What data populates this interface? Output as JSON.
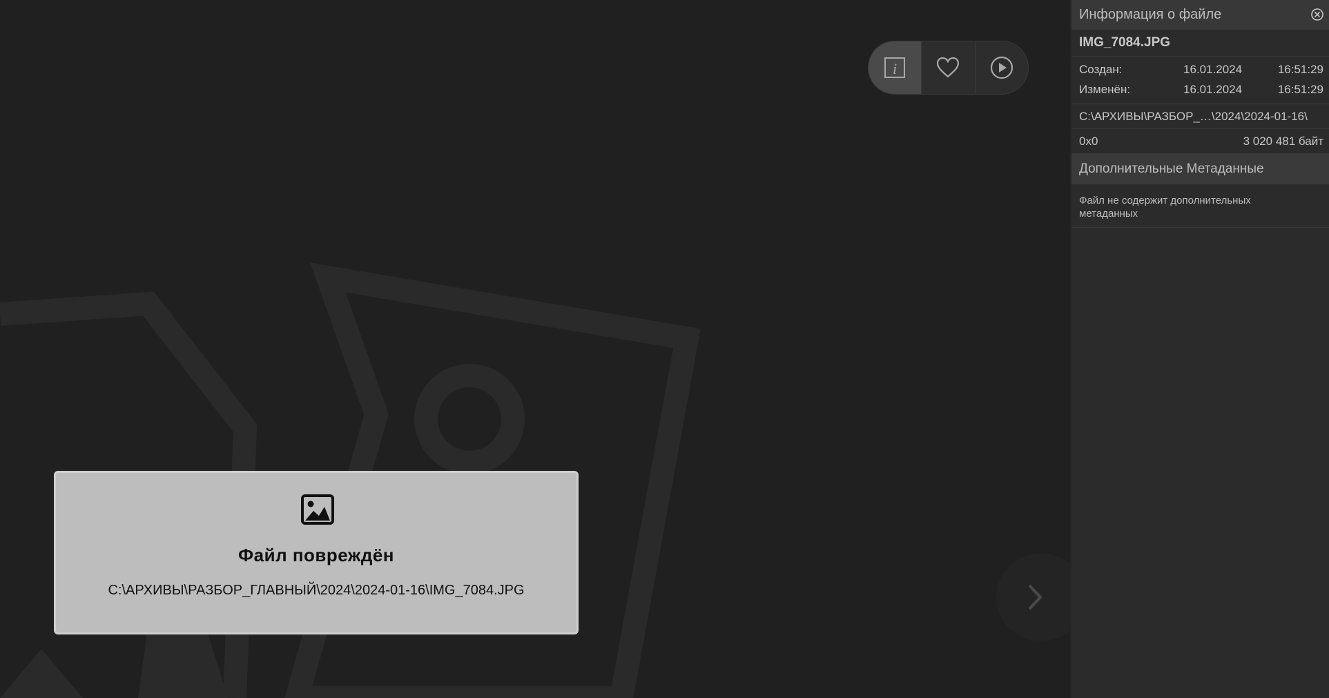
{
  "toolbar": {
    "buttons": [
      {
        "icon": "info-icon",
        "active": true
      },
      {
        "icon": "heart-icon",
        "active": false
      },
      {
        "icon": "play-icon",
        "active": false
      }
    ]
  },
  "error": {
    "icon": "image-icon",
    "title": "Файл повреждён",
    "path": "C:\\АРХИВЫ\\РАЗБОР_ГЛАВНЫЙ\\2024\\2024-01-16\\IMG_7084.JPG"
  },
  "navigation": {
    "next_icon": "chevron-right-icon"
  },
  "panel": {
    "title": "Информация о файле",
    "close_icon": "close-circle-icon",
    "file_name": "IMG_7084.JPG",
    "created": {
      "label": "Создан:",
      "date": "16.01.2024",
      "time": "16:51:29"
    },
    "modified": {
      "label": "Изменён:",
      "date": "16.01.2024",
      "time": "16:51:29"
    },
    "path": "C:\\АРХИВЫ\\РАЗБОР_…\\2024\\2024-01-16\\",
    "dimensions": "0x0",
    "size": "3 020 481 байт",
    "extra_meta_title": "Дополнительные Метаданные",
    "extra_meta_text": "Файл не содержит дополнительных метаданных"
  },
  "colors": {
    "background": "#202020",
    "panel": "#2b2b2b",
    "panel_header": "#383838",
    "error_card": "#bdbdbd",
    "art_stroke": "#2a2a2a"
  }
}
